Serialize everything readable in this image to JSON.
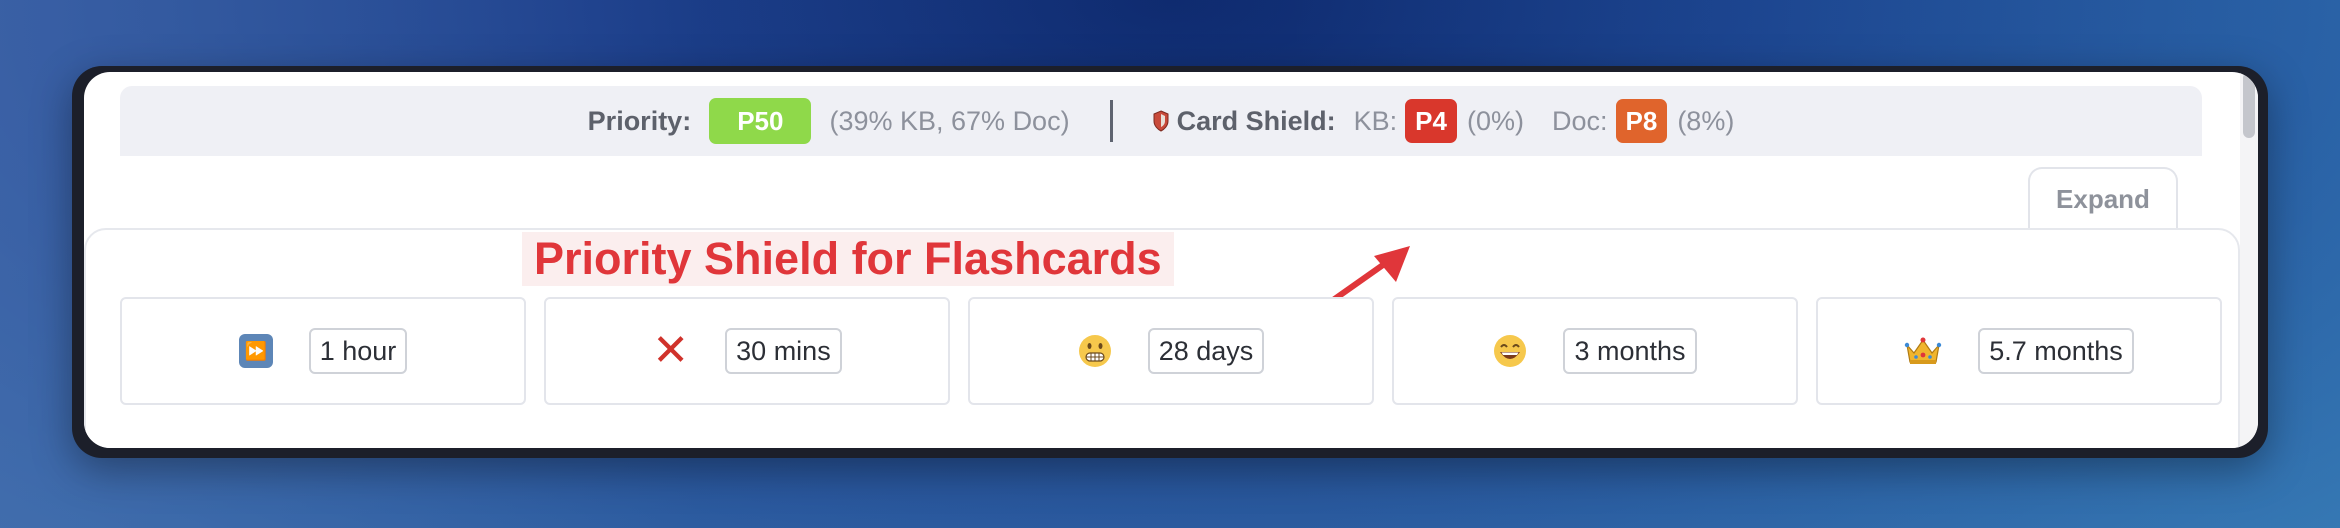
{
  "priority": {
    "label": "Priority:",
    "value": "P50",
    "meta": "(39% KB, 67% Doc)",
    "color": "#8fd94a"
  },
  "shield": {
    "icon": "shield-icon",
    "label": "Card Shield:",
    "kb_label": "KB:",
    "kb_value": "P4",
    "kb_pct": "(0%)",
    "doc_label": "Doc:",
    "doc_value": "P8",
    "doc_pct": "(8%)"
  },
  "expand_label": "Expand",
  "caption": "Priority Shield for Flashcards",
  "cards": [
    {
      "icon": "fast-forward-icon",
      "label": "1 hour"
    },
    {
      "icon": "cross-mark-icon",
      "label": "30 mins"
    },
    {
      "icon": "grimacing-face-icon",
      "label": "28 days"
    },
    {
      "icon": "grinning-face-icon",
      "label": "3 months"
    },
    {
      "icon": "crown-icon",
      "label": "5.7 months"
    }
  ],
  "colors": {
    "accent_red": "#e0363a",
    "kb_pill": "#d9372c",
    "doc_pill": "#e0642c"
  }
}
